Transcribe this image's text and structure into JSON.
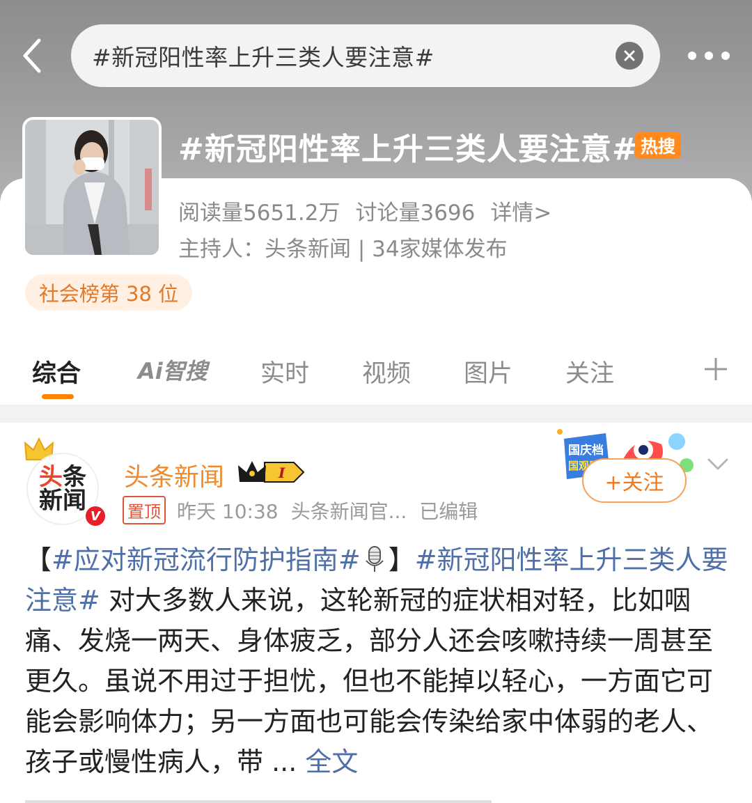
{
  "header": {
    "search_query": "#新冠阳性率上升三类人要注意#"
  },
  "topic": {
    "title": "#新冠阳性率上升三类人要注意#",
    "hot_badge": "热搜",
    "reads": "阅读量5651.2万",
    "discussions": "讨论量3696",
    "details": "详情>",
    "host_line": "主持人：头条新闻 | 34家媒体发布",
    "rank": "社会榜第 38 位"
  },
  "tabs": {
    "items": [
      "综合",
      "实时",
      "视频",
      "图片",
      "关注"
    ],
    "ai_label": "Ai智搜",
    "active": "综合"
  },
  "post": {
    "avatar_line1": "头条",
    "avatar_line2": "新闻",
    "author": "头条新闻",
    "vip_level": "I",
    "pin_label": "置顶",
    "time": "昨天 10:38",
    "source": "头条新闻官...",
    "edited": "已编辑",
    "follow_label": "+关注",
    "sticker_text": "国庆档 国观影",
    "bracket_open": "【",
    "tag1": "#应对新冠流行防护指南#",
    "bracket_close": "】",
    "tag2": "#新冠阳性率上升三类人要注意#",
    "body": " 对大多数人来说，这轮新冠的症状相对轻，比如咽痛、发烧一两天、身体疲乏，部分人还会咳嗽持续一周甚至更久。虽说不用过于担忧，但也不能掉以轻心，一方面它可能会影响体力；另一方面也可能会传染给家中体弱的老人、孩子或慢性病人，带 ...",
    "full_text": "全文"
  },
  "colors": {
    "accent": "#ff8200",
    "link": "#4e6fa8",
    "author": "#f08a2c",
    "hot_badge": "#ff8a1f"
  }
}
